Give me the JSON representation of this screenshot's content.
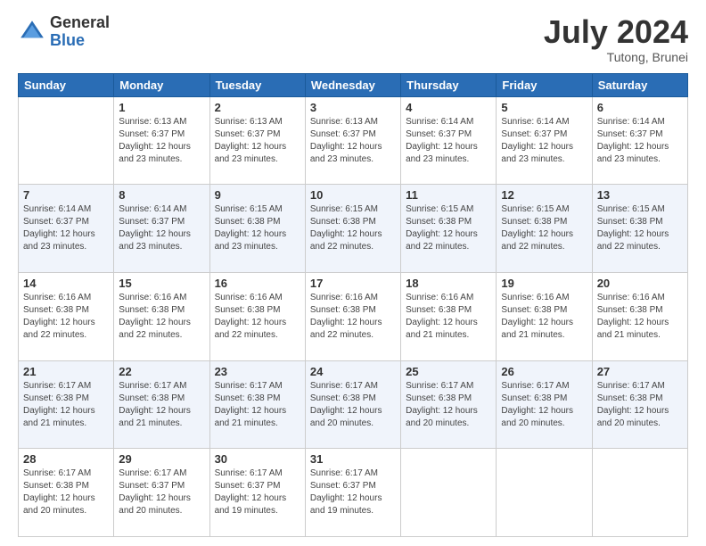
{
  "logo": {
    "general": "General",
    "blue": "Blue"
  },
  "header": {
    "month_year": "July 2024",
    "location": "Tutong, Brunei"
  },
  "weekdays": [
    "Sunday",
    "Monday",
    "Tuesday",
    "Wednesday",
    "Thursday",
    "Friday",
    "Saturday"
  ],
  "weeks": [
    [
      {
        "day": "",
        "info": ""
      },
      {
        "day": "1",
        "info": "Sunrise: 6:13 AM\nSunset: 6:37 PM\nDaylight: 12 hours\nand 23 minutes."
      },
      {
        "day": "2",
        "info": "Sunrise: 6:13 AM\nSunset: 6:37 PM\nDaylight: 12 hours\nand 23 minutes."
      },
      {
        "day": "3",
        "info": "Sunrise: 6:13 AM\nSunset: 6:37 PM\nDaylight: 12 hours\nand 23 minutes."
      },
      {
        "day": "4",
        "info": "Sunrise: 6:14 AM\nSunset: 6:37 PM\nDaylight: 12 hours\nand 23 minutes."
      },
      {
        "day": "5",
        "info": "Sunrise: 6:14 AM\nSunset: 6:37 PM\nDaylight: 12 hours\nand 23 minutes."
      },
      {
        "day": "6",
        "info": "Sunrise: 6:14 AM\nSunset: 6:37 PM\nDaylight: 12 hours\nand 23 minutes."
      }
    ],
    [
      {
        "day": "7",
        "info": "Sunrise: 6:14 AM\nSunset: 6:37 PM\nDaylight: 12 hours\nand 23 minutes."
      },
      {
        "day": "8",
        "info": "Sunrise: 6:14 AM\nSunset: 6:37 PM\nDaylight: 12 hours\nand 23 minutes."
      },
      {
        "day": "9",
        "info": "Sunrise: 6:15 AM\nSunset: 6:38 PM\nDaylight: 12 hours\nand 23 minutes."
      },
      {
        "day": "10",
        "info": "Sunrise: 6:15 AM\nSunset: 6:38 PM\nDaylight: 12 hours\nand 22 minutes."
      },
      {
        "day": "11",
        "info": "Sunrise: 6:15 AM\nSunset: 6:38 PM\nDaylight: 12 hours\nand 22 minutes."
      },
      {
        "day": "12",
        "info": "Sunrise: 6:15 AM\nSunset: 6:38 PM\nDaylight: 12 hours\nand 22 minutes."
      },
      {
        "day": "13",
        "info": "Sunrise: 6:15 AM\nSunset: 6:38 PM\nDaylight: 12 hours\nand 22 minutes."
      }
    ],
    [
      {
        "day": "14",
        "info": "Sunrise: 6:16 AM\nSunset: 6:38 PM\nDaylight: 12 hours\nand 22 minutes."
      },
      {
        "day": "15",
        "info": "Sunrise: 6:16 AM\nSunset: 6:38 PM\nDaylight: 12 hours\nand 22 minutes."
      },
      {
        "day": "16",
        "info": "Sunrise: 6:16 AM\nSunset: 6:38 PM\nDaylight: 12 hours\nand 22 minutes."
      },
      {
        "day": "17",
        "info": "Sunrise: 6:16 AM\nSunset: 6:38 PM\nDaylight: 12 hours\nand 22 minutes."
      },
      {
        "day": "18",
        "info": "Sunrise: 6:16 AM\nSunset: 6:38 PM\nDaylight: 12 hours\nand 21 minutes."
      },
      {
        "day": "19",
        "info": "Sunrise: 6:16 AM\nSunset: 6:38 PM\nDaylight: 12 hours\nand 21 minutes."
      },
      {
        "day": "20",
        "info": "Sunrise: 6:16 AM\nSunset: 6:38 PM\nDaylight: 12 hours\nand 21 minutes."
      }
    ],
    [
      {
        "day": "21",
        "info": "Sunrise: 6:17 AM\nSunset: 6:38 PM\nDaylight: 12 hours\nand 21 minutes."
      },
      {
        "day": "22",
        "info": "Sunrise: 6:17 AM\nSunset: 6:38 PM\nDaylight: 12 hours\nand 21 minutes."
      },
      {
        "day": "23",
        "info": "Sunrise: 6:17 AM\nSunset: 6:38 PM\nDaylight: 12 hours\nand 21 minutes."
      },
      {
        "day": "24",
        "info": "Sunrise: 6:17 AM\nSunset: 6:38 PM\nDaylight: 12 hours\nand 20 minutes."
      },
      {
        "day": "25",
        "info": "Sunrise: 6:17 AM\nSunset: 6:38 PM\nDaylight: 12 hours\nand 20 minutes."
      },
      {
        "day": "26",
        "info": "Sunrise: 6:17 AM\nSunset: 6:38 PM\nDaylight: 12 hours\nand 20 minutes."
      },
      {
        "day": "27",
        "info": "Sunrise: 6:17 AM\nSunset: 6:38 PM\nDaylight: 12 hours\nand 20 minutes."
      }
    ],
    [
      {
        "day": "28",
        "info": "Sunrise: 6:17 AM\nSunset: 6:38 PM\nDaylight: 12 hours\nand 20 minutes."
      },
      {
        "day": "29",
        "info": "Sunrise: 6:17 AM\nSunset: 6:37 PM\nDaylight: 12 hours\nand 20 minutes."
      },
      {
        "day": "30",
        "info": "Sunrise: 6:17 AM\nSunset: 6:37 PM\nDaylight: 12 hours\nand 19 minutes."
      },
      {
        "day": "31",
        "info": "Sunrise: 6:17 AM\nSunset: 6:37 PM\nDaylight: 12 hours\nand 19 minutes."
      },
      {
        "day": "",
        "info": ""
      },
      {
        "day": "",
        "info": ""
      },
      {
        "day": "",
        "info": ""
      }
    ]
  ]
}
